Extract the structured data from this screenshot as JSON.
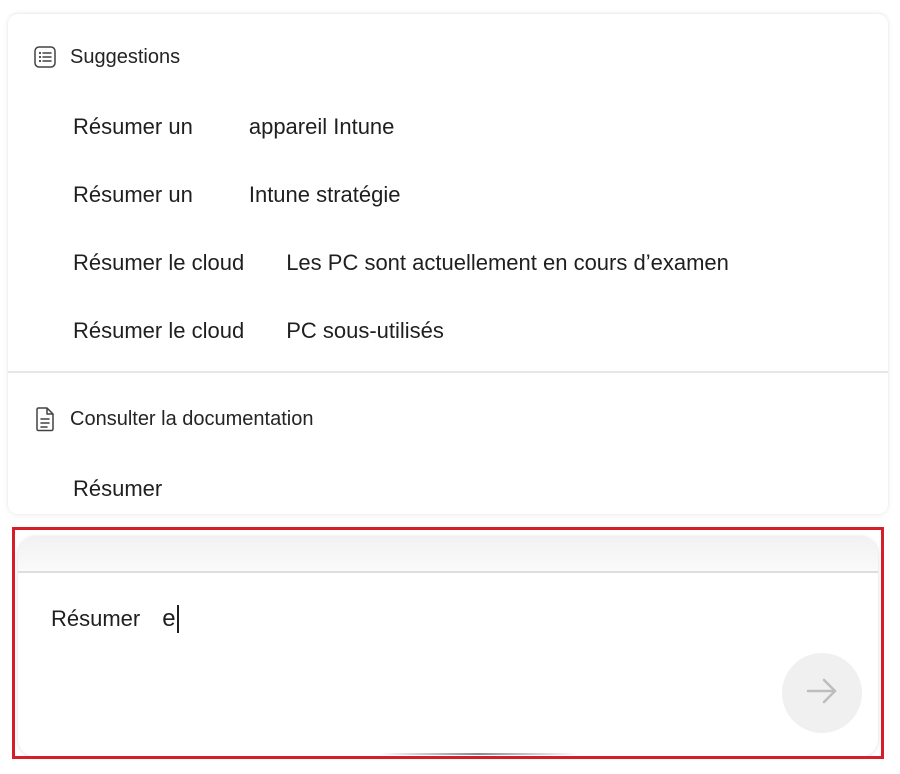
{
  "suggestions": {
    "header_label": "Suggestions",
    "header_icon": "list-icon",
    "items": [
      {
        "part1": "Résumer un",
        "part2": "appareil Intune"
      },
      {
        "part1": "Résumer un",
        "part2": "Intune stratégie"
      },
      {
        "part1": "Résumer le cloud",
        "part2": "Les PC sont actuellement en cours d’examen"
      },
      {
        "part1": "Résumer le cloud",
        "part2": "PC sous-utilisés"
      }
    ]
  },
  "documentation": {
    "header_label": "Consulter la documentation",
    "header_icon": "document-icon",
    "items": [
      {
        "part1": "Résumer"
      }
    ]
  },
  "prompt": {
    "prefix": "Résumer",
    "typed": "e",
    "send_icon": "arrow-right-icon"
  },
  "colors": {
    "highlight_border": "#d41f2b",
    "send_button_bg": "#f0f0f0",
    "send_arrow": "#bdbdbd"
  }
}
